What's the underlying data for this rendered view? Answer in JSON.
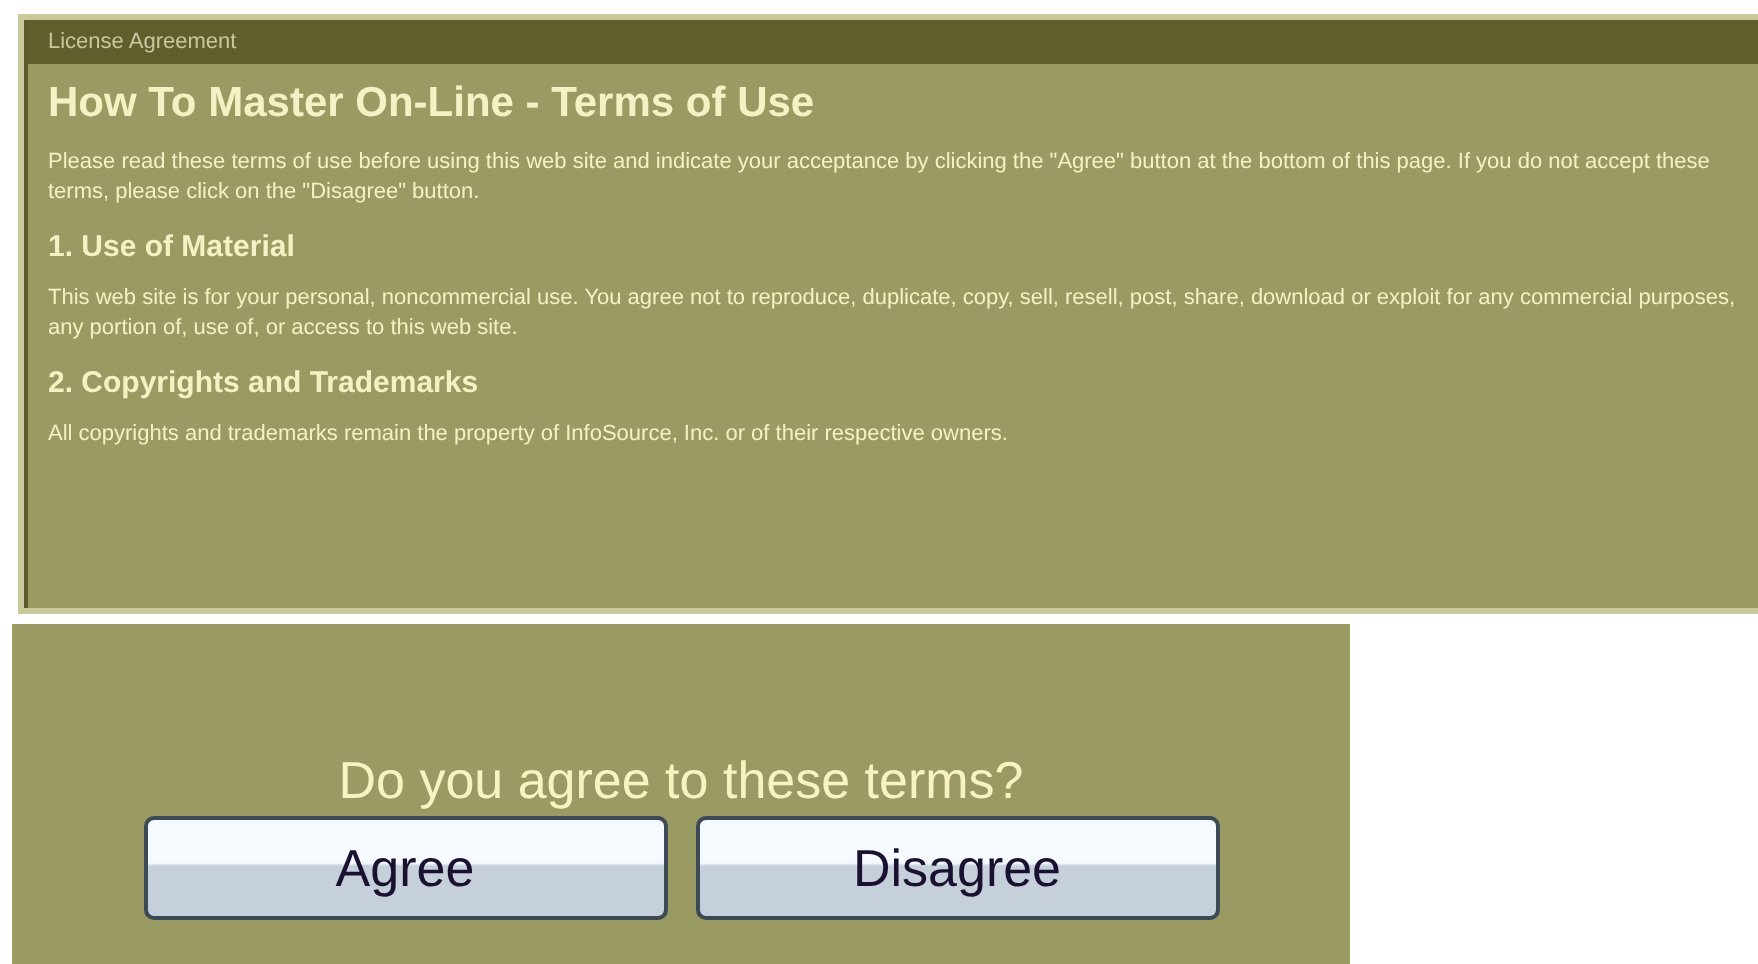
{
  "panel": {
    "title": "License Agreement",
    "heading": "How To Master On-Line - Terms of Use",
    "intro": "Please read these terms of use before using this web site and indicate your acceptance by clicking the \"Agree\" button at the bottom of this page. If you do not accept these terms, please click on the \"Disagree\" button.",
    "sections": [
      {
        "heading": "1. Use of Material",
        "text": "This web site is for your personal, noncommercial use. You agree not to reproduce, duplicate, copy, sell, resell, post, share, download or exploit for any commercial purposes, any portion of, use of, or access to this web site."
      },
      {
        "heading": "2. Copyrights and Trademarks",
        "text": "All copyrights and trademarks remain the property of InfoSource, Inc. or of their respective owners."
      }
    ]
  },
  "prompt": {
    "question": "Do you agree to these terms?",
    "buttons": [
      "Agree",
      "Disagree"
    ]
  }
}
